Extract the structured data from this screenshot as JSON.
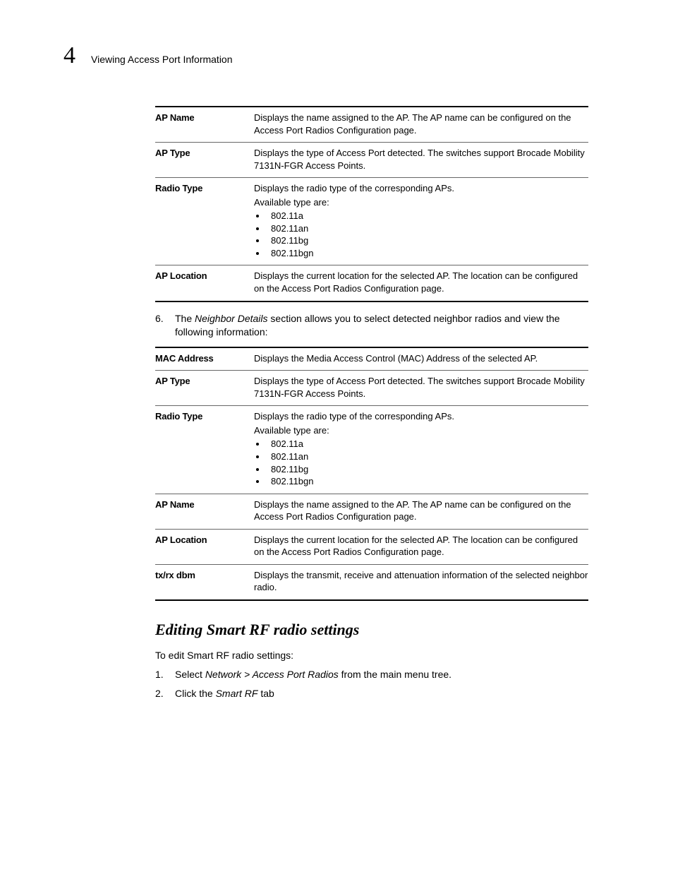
{
  "header": {
    "chapter_number": "4",
    "section_title": "Viewing Access Port Information"
  },
  "table1": {
    "rows": [
      {
        "label": "AP Name",
        "desc": [
          "Displays the name assigned to the AP. The AP name can be configured on the Access Port Radios Configuration page."
        ]
      },
      {
        "label": "AP Type",
        "desc": [
          "Displays the type of Access Port detected. The switches support Brocade Mobility 7131N-FGR Access Points."
        ]
      },
      {
        "label": "Radio Type",
        "desc": [
          "Displays the radio type of the corresponding APs.",
          "Available type are:"
        ],
        "list": [
          "802.11a",
          "802.11an",
          "802.11bg",
          "802.11bgn"
        ]
      },
      {
        "label": "AP Location",
        "desc": [
          "Displays the current location for the selected AP. The location can be configured on the Access Port Radios Configuration page."
        ]
      }
    ]
  },
  "step6": {
    "num": "6.",
    "text_pre": "The ",
    "text_em": "Neighbor Details",
    "text_post": " section allows you to select detected neighbor radios and view the following information:"
  },
  "table2": {
    "rows": [
      {
        "label": "MAC Address",
        "desc": [
          "Displays the Media Access Control (MAC) Address of the selected AP."
        ]
      },
      {
        "label": "AP Type",
        "desc": [
          "Displays the type of Access Port detected. The switches support Brocade Mobility 7131N-FGR Access Points."
        ]
      },
      {
        "label": "Radio Type",
        "desc": [
          "Displays the radio type of the corresponding APs.",
          "Available type are:"
        ],
        "list": [
          "802.11a",
          "802.11an",
          "802.11bg",
          "802.11bgn"
        ]
      },
      {
        "label": "AP Name",
        "desc": [
          "Displays the name assigned to the AP. The AP name can be configured on the Access Port Radios Configuration page."
        ]
      },
      {
        "label": "AP Location",
        "desc": [
          "Displays the current location for the selected AP. The location can be configured on the Access Port Radios Configuration page."
        ]
      },
      {
        "label": "tx/rx dbm",
        "desc": [
          "Displays the transmit, receive and attenuation information of the selected neighbor radio."
        ]
      }
    ]
  },
  "section_heading": "Editing Smart RF radio settings",
  "intro_para": "To edit Smart RF radio settings:",
  "steps": [
    {
      "num": "1.",
      "pre": "Select ",
      "em": "Network > Access Port Radios",
      "post": " from the main menu tree."
    },
    {
      "num": "2.",
      "pre": "Click the ",
      "em": "Smart RF",
      "post": " tab"
    }
  ]
}
